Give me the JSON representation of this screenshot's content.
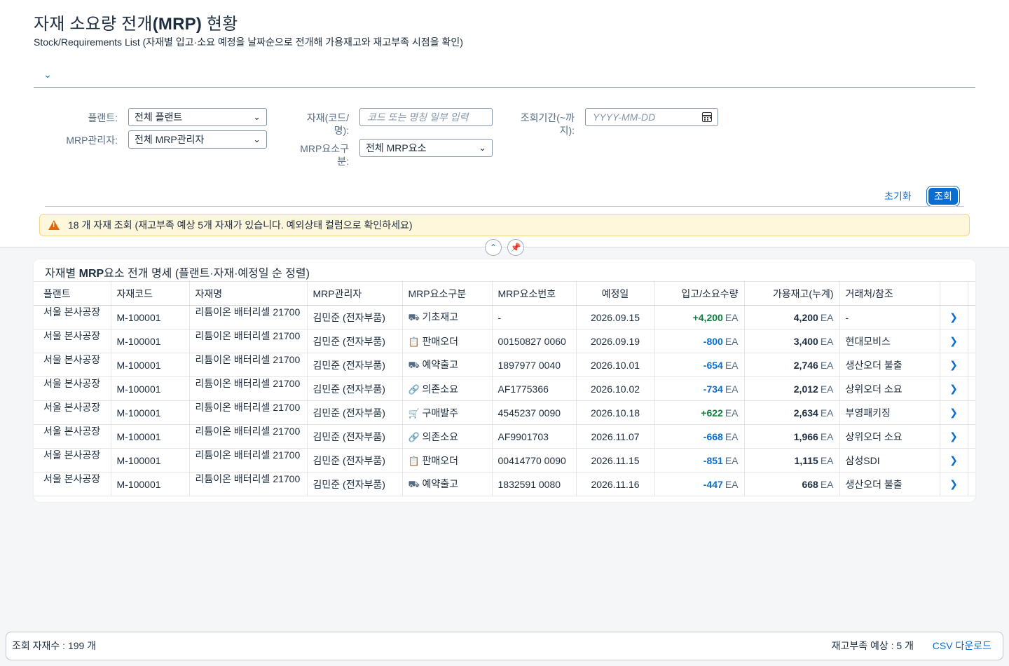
{
  "header": {
    "title_pre": "자재 소요량 전개",
    "title_bold": "(MRP)",
    "title_post": " 현황",
    "subtitle": "Stock/Requirements List (자재별 입고·소요 예정을 날짜순으로 전개해 가용재고와 재고부족 시점을 확인)"
  },
  "filters": {
    "plant_label": "플랜트:",
    "plant_value": "전체 플랜트",
    "mrp_controller_label": "MRP관리자:",
    "mrp_controller_value": "전체 MRP관리자",
    "material_label": "자재(코드/명):",
    "material_placeholder": "코드 또는 명칭 일부 입력",
    "mrp_element_label": "MRP요소구분:",
    "mrp_element_value": "전체 MRP요소",
    "period_label": "조회기간(~까지):",
    "period_placeholder": "YYYY-MM-DD",
    "reset_label": "초기화",
    "search_label": "조회"
  },
  "message": {
    "text": "18 개 자재 조회 (재고부족 예상 5개 자재가 있습니다. 예외상태 컬럼으로 확인하세요)",
    "color": "#e76500"
  },
  "table": {
    "title_pre": "자재별 ",
    "title_bold": "MRP",
    "title_post": "요소 전개 명세 (플랜트·자재·예정일 순 정렬)",
    "columns": [
      "플랜트",
      "자재코드",
      "자재명",
      "MRP관리자",
      "MRP요소구분",
      "MRP요소번호",
      "예정일",
      "입고/소요수량",
      "가용재고(누계)",
      "거래처/참조"
    ],
    "rows": [
      {
        "plant": "서울 본사공장",
        "code": "M-100001",
        "name": "리튬이온 배터리셀 21700",
        "controller": "김민준 (전자부품)",
        "icon": "truck-icon",
        "glyph": "⛟",
        "element": "기초재고",
        "number": "-",
        "date": "2026.09.15",
        "qty": "+4,200",
        "unit": "EA",
        "stock": "4,200",
        "ref": "-"
      },
      {
        "plant": "서울 본사공장",
        "code": "M-100001",
        "name": "리튬이온 배터리셀 21700",
        "controller": "김민준 (전자부품)",
        "icon": "clipboard-icon",
        "glyph": "📋",
        "element": "판매오더",
        "number": "00150827 0060",
        "date": "2026.09.19",
        "qty": "-800",
        "unit": "EA",
        "stock": "3,400",
        "ref": "현대모비스"
      },
      {
        "plant": "서울 본사공장",
        "code": "M-100001",
        "name": "리튬이온 배터리셀 21700",
        "controller": "김민준 (전자부품)",
        "icon": "shipping-icon",
        "glyph": "⛟",
        "element": "예약출고",
        "number": "1897977 0040",
        "date": "2026.10.01",
        "qty": "-654",
        "unit": "EA",
        "stock": "2,746",
        "ref": "생산오더 불출"
      },
      {
        "plant": "서울 본사공장",
        "code": "M-100001",
        "name": "리튬이온 배터리셀 21700",
        "controller": "김민준 (전자부품)",
        "icon": "link-icon",
        "glyph": "🔗",
        "element": "의존소요",
        "number": "AF1775366",
        "date": "2026.10.02",
        "qty": "-734",
        "unit": "EA",
        "stock": "2,012",
        "ref": "상위오더 소요"
      },
      {
        "plant": "서울 본사공장",
        "code": "M-100001",
        "name": "리튬이온 배터리셀 21700",
        "controller": "김민준 (전자부품)",
        "icon": "cart-icon",
        "glyph": "🛒",
        "element": "구매발주",
        "number": "4545237 0090",
        "date": "2026.10.18",
        "qty": "+622",
        "unit": "EA",
        "stock": "2,634",
        "ref": "부영패키징"
      },
      {
        "plant": "서울 본사공장",
        "code": "M-100001",
        "name": "리튬이온 배터리셀 21700",
        "controller": "김민준 (전자부품)",
        "icon": "link-icon",
        "glyph": "🔗",
        "element": "의존소요",
        "number": "AF9901703",
        "date": "2026.11.07",
        "qty": "-668",
        "unit": "EA",
        "stock": "1,966",
        "ref": "상위오더 소요"
      },
      {
        "plant": "서울 본사공장",
        "code": "M-100001",
        "name": "리튬이온 배터리셀 21700",
        "controller": "김민준 (전자부품)",
        "icon": "clipboard-icon",
        "glyph": "📋",
        "element": "판매오더",
        "number": "00414770 0090",
        "date": "2026.11.15",
        "qty": "-851",
        "unit": "EA",
        "stock": "1,115",
        "ref": "삼성SDI"
      },
      {
        "plant": "서울 본사공장",
        "code": "M-100001",
        "name": "리튬이온 배터리셀 21700",
        "controller": "김민준 (전자부품)",
        "icon": "shipping-icon",
        "glyph": "⛟",
        "element": "예약출고",
        "number": "1832591 0080",
        "date": "2026.11.16",
        "qty": "-447",
        "unit": "EA",
        "stock": "668",
        "ref": "생산오더 불출"
      }
    ]
  },
  "footer": {
    "count_text": "조회 자재수 : 199 개",
    "shortage_text": "재고부족 예상 : 5 개",
    "csv_label": "CSV 다운로드"
  }
}
